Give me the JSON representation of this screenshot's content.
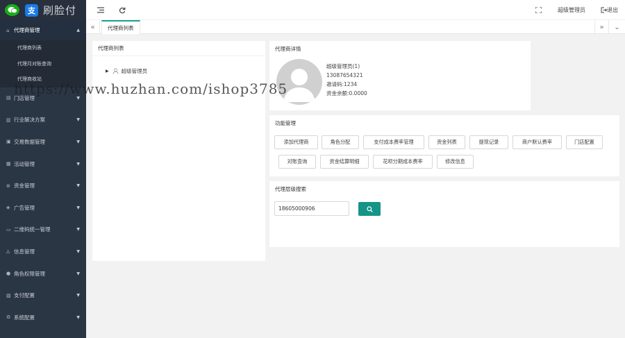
{
  "logo": {
    "wechat_icon": "wechat-icon",
    "alipay_glyph": "支",
    "text": "刷脸付"
  },
  "sidebar": {
    "open_menu": {
      "label": "代理商管理",
      "icon": "home-icon"
    },
    "sub_items": [
      "代理商列表",
      "代理月对账查询",
      "代理商收站"
    ],
    "items": [
      {
        "label": "门店管理",
        "icon": "store-icon"
      },
      {
        "label": "行业解决方案",
        "icon": "industry-icon"
      },
      {
        "label": "交易数据管理",
        "icon": "data-icon"
      },
      {
        "label": "活动管理",
        "icon": "activity-icon"
      },
      {
        "label": "资金管理",
        "icon": "fund-icon"
      },
      {
        "label": "广告管理",
        "icon": "ad-icon"
      },
      {
        "label": "二维码统一管理",
        "icon": "qrcode-icon"
      },
      {
        "label": "信息管理",
        "icon": "bell-icon"
      },
      {
        "label": "角色权限管理",
        "icon": "users-icon"
      },
      {
        "label": "支付配置",
        "icon": "pay-config-icon"
      },
      {
        "label": "系统配置",
        "icon": "settings-icon"
      }
    ]
  },
  "topbar": {
    "user": "超级管理员",
    "logout": "退出"
  },
  "tabs": {
    "active": "代理商列表"
  },
  "tree_panel": {
    "title": "代理商列表",
    "root_node": "超级管理员"
  },
  "detail_panel": {
    "title": "代理商详情",
    "name": "超级管理员(1)",
    "phone": "13087654321",
    "code": "邀请码:1234",
    "balance": "资金余额:0.0000"
  },
  "function_panel": {
    "title": "功能管理",
    "buttons": [
      "添加代理商",
      "角色分配",
      "支付成本费率管理",
      "资金列表",
      "提现记录",
      "商户默认费率",
      "门店配置",
      "对账查询",
      "资金结算明细",
      "花呗分期成本费率",
      "修改信息"
    ]
  },
  "search_panel": {
    "title": "代理层级搜索",
    "input_value": "18605000906"
  },
  "watermark": "https://www.huzhan.com/ishop3785"
}
